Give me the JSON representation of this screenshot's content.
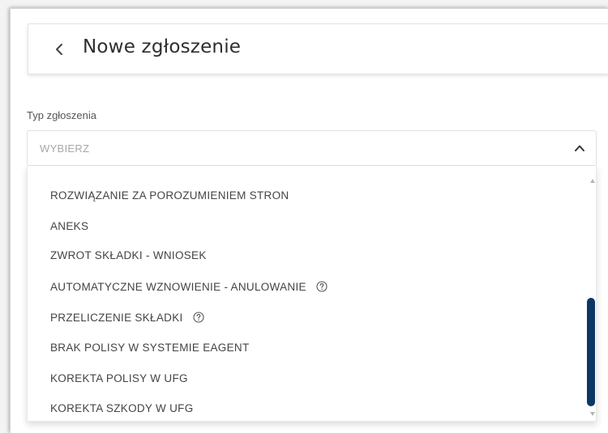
{
  "header": {
    "title": "Nowe zgłoszenie",
    "back_icon": "chevron-left-icon"
  },
  "form": {
    "field_label": "Typ zgłoszenia",
    "select": {
      "placeholder": "WYBIERZ",
      "expanded": true,
      "toggle_icon": "chevron-up-icon"
    }
  },
  "dropdown": {
    "options": [
      {
        "label": "ROZWIĄZANIE ZA POROZUMIENIEM STRON",
        "help": false
      },
      {
        "label": "ANEKS",
        "help": false
      },
      {
        "label": "ZWROT SKŁADKI - WNIOSEK",
        "help": false
      },
      {
        "label": "AUTOMATYCZNE WZNOWIENIE - ANULOWANIE",
        "help": true
      },
      {
        "label": "PRZELICZENIE SKŁADKI",
        "help": true
      },
      {
        "label": "BRAK POLISY W SYSTEMIE EAGENT",
        "help": false
      },
      {
        "label": "KOREKTA POLISY W UFG",
        "help": false
      },
      {
        "label": "KOREKTA SZKODY W UFG",
        "help": false
      }
    ],
    "help_icon": "question-circle-icon",
    "scrollbar": {
      "thumb_color": "#0c3765"
    }
  },
  "colors": {
    "accent": "#0c3765",
    "text": "#444444",
    "placeholder": "#a8a8a8"
  }
}
